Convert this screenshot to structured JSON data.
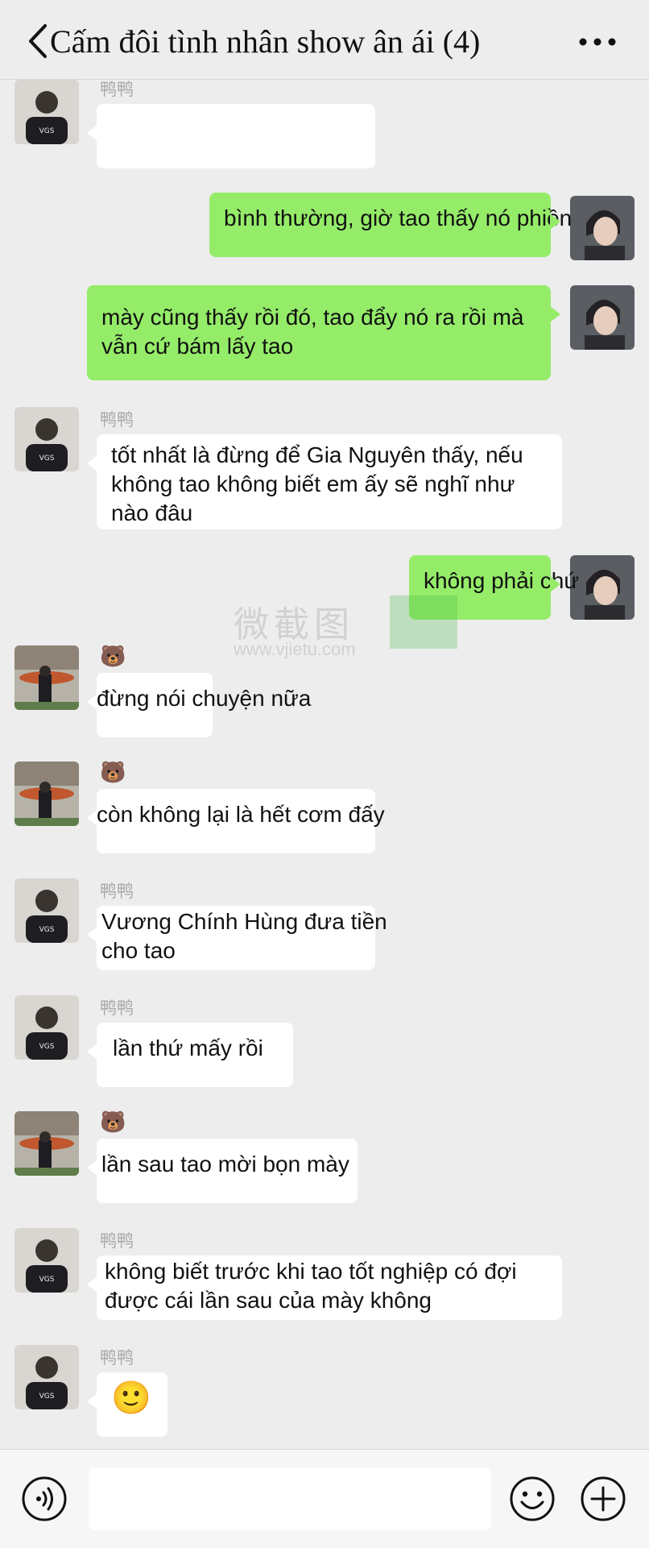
{
  "header": {
    "title": "Cấm đôi tình nhân show ân ái (4)",
    "back_icon": "chevron-left-icon",
    "more_icon": "more-dots-icon"
  },
  "watermark": {
    "text": "微截图",
    "url": "www.vjietu.com"
  },
  "messages": [
    {
      "side": "left",
      "sender": "鸭鸭",
      "lines": [
        ""
      ]
    },
    {
      "side": "right",
      "lines": [
        "bình thường, giờ tao thấy nó phiền"
      ]
    },
    {
      "side": "right",
      "lines": [
        "mày cũng thấy rồi đó, tao đẩy nó ra rồi mà",
        "vẫn cứ bám lấy tao"
      ]
    },
    {
      "side": "left",
      "sender": "鸭鸭",
      "lines": [
        "tốt nhất là đừng để Gia Nguyên thấy, nếu",
        "không tao không biết em ấy sẽ nghĩ như",
        "nào đâu"
      ]
    },
    {
      "side": "right",
      "lines": [
        "không phải chứ"
      ]
    },
    {
      "side": "left",
      "sender": "🐻",
      "lines": [
        "đừng nói chuyện nữa"
      ]
    },
    {
      "side": "left",
      "sender": "🐻",
      "lines": [
        "còn không lại là hết cơm đấy"
      ]
    },
    {
      "side": "left",
      "sender": "鸭鸭",
      "lines": [
        "Vương Chính Hùng đưa tiền",
        "cho tao"
      ]
    },
    {
      "side": "left",
      "sender": "鸭鸭",
      "lines": [
        "lần thứ mấy rồi"
      ]
    },
    {
      "side": "left",
      "sender": "🐻",
      "lines": [
        "lần sau tao mời bọn mày"
      ]
    },
    {
      "side": "left",
      "sender": "鸭鸭",
      "lines": [
        "không biết trước khi tao tốt nghiệp có đợi",
        "được cái lần sau của mày không"
      ]
    },
    {
      "side": "left",
      "sender": "鸭鸭",
      "lines": [
        "🙂"
      ]
    }
  ],
  "bottom_bar": {
    "voice_icon": "voice-icon",
    "input_value": "",
    "emoji_icon": "emoji-icon",
    "plus_icon": "plus-icon"
  },
  "colors": {
    "background": "#ededed",
    "bubble_green": "#95ec69",
    "bubble_white": "#ffffff",
    "nickname": "#a8a8a8"
  }
}
